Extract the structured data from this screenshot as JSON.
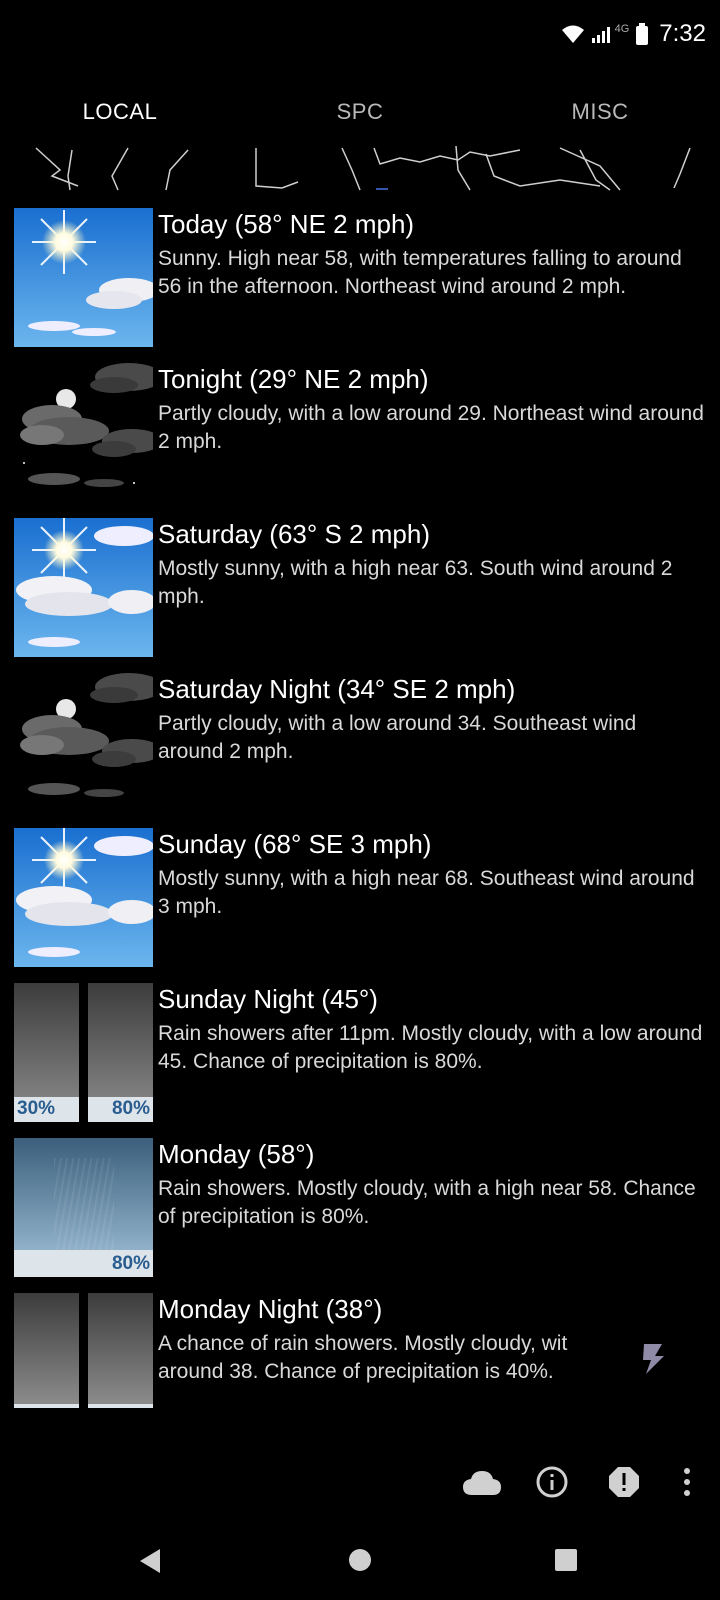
{
  "status_bar": {
    "time": "7:32",
    "network": "4G",
    "icons": [
      "wifi-icon",
      "signal-icon",
      "battery-icon"
    ]
  },
  "tabs": [
    {
      "label": "LOCAL",
      "active": true
    },
    {
      "label": "SPC",
      "active": false
    },
    {
      "label": "MISC",
      "active": false
    }
  ],
  "forecast": [
    {
      "title": "Today (58° NE 2 mph)",
      "desc": "Sunny. High near 58, with temperatures falling to around 56 in the afternoon. Northeast wind around 2 mph.",
      "icon": "sunny"
    },
    {
      "title": "Tonight (29° NE 2 mph)",
      "desc": "Partly cloudy, with a low around 29. Northeast wind around 2 mph.",
      "icon": "partly-cloudy-night"
    },
    {
      "title": "Saturday (63° S 2 mph)",
      "desc": "Mostly sunny, with a high near 63. South wind around 2 mph.",
      "icon": "mostly-sunny"
    },
    {
      "title": "Saturday Night (34° SE 2 mph)",
      "desc": "Partly cloudy, with a low around 34. Southeast wind around 2 mph.",
      "icon": "partly-cloudy-night"
    },
    {
      "title": "Sunday (68° SE 3 mph)",
      "desc": "Mostly sunny, with a high near 68. Southeast wind around 3 mph.",
      "icon": "mostly-sunny"
    },
    {
      "title": "Sunday Night (45°)",
      "desc": "Rain showers after 11pm. Mostly cloudy, with a low around 45. Chance of precipitation is 80%.",
      "icon": "rain-split",
      "pct_left": "30%",
      "pct_right": "80%"
    },
    {
      "title": "Monday (58°)",
      "desc": "Rain showers. Mostly cloudy, with a high near 58. Chance of precipitation is 80%.",
      "icon": "rain",
      "pct_right": "80%"
    },
    {
      "title": "Monday Night (38°)",
      "desc": "A chance of rain showers. Mostly cloudy, wit around 38. Chance of precipitation is 40%.",
      "icon": "rain-split"
    }
  ],
  "actions": [
    "cloud-icon",
    "info-icon",
    "alert-icon",
    "more-vert-icon"
  ],
  "nav": [
    "back-icon",
    "home-icon",
    "recents-icon"
  ]
}
